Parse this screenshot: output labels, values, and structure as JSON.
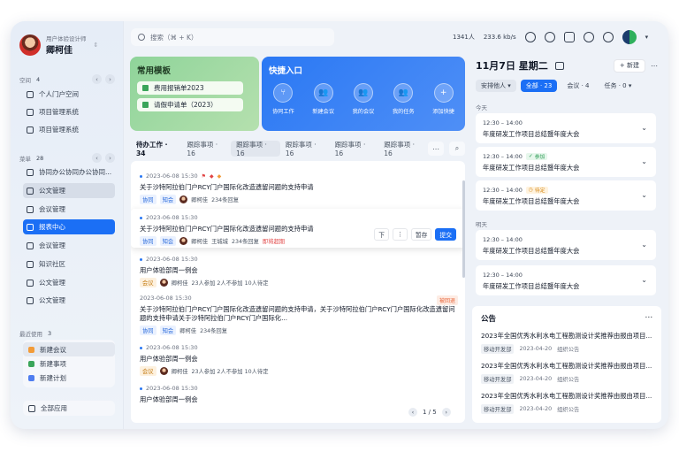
{
  "user": {
    "role": "用户体验设计师",
    "name": "卿柯佳"
  },
  "sidebar": {
    "space": {
      "label": "空间",
      "count": "4"
    },
    "space_items": [
      "个人门户空间",
      "项目管理系统",
      "项目管理系统"
    ],
    "menu": {
      "label": "菜单",
      "count": "28"
    },
    "menu_items": [
      "协同办公协同办公协同...",
      "公文管理",
      "会议管理",
      "报表中心",
      "会议管理",
      "知识社区",
      "公文管理",
      "公文管理"
    ],
    "recent": {
      "label": "最近使用",
      "count": "3"
    },
    "recent_items": [
      "新建会议",
      "新建事项",
      "新建计划"
    ],
    "all_apps": "全部应用"
  },
  "topbar": {
    "search_placeholder": "搜索（⌘ + K）",
    "users": "1341人",
    "speed": "233.6 kb/s",
    "icons": [
      "chat-icon",
      "contact-icon",
      "apps-icon",
      "headset-icon",
      "settings-icon"
    ]
  },
  "templates": {
    "title": "常用模板",
    "items": [
      "费用报销单2023",
      "请假申请单（2023）"
    ]
  },
  "quick": {
    "title": "快捷入口",
    "items": [
      "协同工作",
      "新建会议",
      "我的会议",
      "我的任务",
      "添加快捷"
    ]
  },
  "tabs": {
    "items": [
      "待办工作 · 34",
      "跟踪事项 · 16",
      "跟踪事项 · 16",
      "跟踪事项 · 16",
      "跟踪事项 · 16",
      "跟踪事项 · 16"
    ]
  },
  "list": {
    "items": [
      {
        "date": "2023-06-08 15:30",
        "title": "关于沙特阿拉伯门户RCY门户国际化改造遗留问题的支持申请",
        "tags": [
          "协同",
          "知会"
        ],
        "person": "卿柯佳",
        "extra": "234条回复"
      },
      {
        "date": "2023-06-08 15:30",
        "title": "关于沙特阿拉伯门户RCY门户国际化改造遗留问题的支持申请",
        "tags": [
          "协同",
          "知会"
        ],
        "person": "卿柯佳",
        "extra": "王城城",
        "extra2": "234条回复",
        "warn": "即将超期",
        "actions": [
          "下",
          "⋮",
          "暂存",
          "提交"
        ]
      },
      {
        "date": "2023-06-08 15:30",
        "title": "用户体验部周一例会",
        "tags": [
          "会议"
        ],
        "person": "卿柯佳",
        "extra": "23人参加 2人不参加 10人待定"
      },
      {
        "date": "2023-06-08 15:30",
        "title": "关于沙特阿拉伯门户RCY门户国际化改造遗留问题的支持申请，关于沙特阿拉伯门户RCY门户国际化改造遗留问题的支持申请关于沙特阿拉伯门户RCY门户国际化...",
        "tags": [
          "协同",
          "知会"
        ],
        "person": "卿柯佳",
        "extra": "234条回复",
        "rtag": "被回退"
      },
      {
        "date": "2023-06-08 15:30",
        "title": "用户体验部周一例会",
        "tags": [
          "会议"
        ],
        "person": "卿柯佳",
        "extra": "23人参加 2人不参加 10人待定"
      },
      {
        "date": "2023-06-08 15:30",
        "title": "用户体验部周一例会"
      }
    ],
    "pager": "1 / 5"
  },
  "calendar": {
    "date": "11月7日 星期二",
    "new_label": "+ 新建",
    "filters": [
      "安排他人 ▾",
      "全部 · 23",
      "会议 · 4",
      "任务 · 0 ▾"
    ],
    "today": "今天",
    "tomorrow": "明天",
    "events": [
      {
        "time": "12:30 – 14:00",
        "name": "年度研发工作项目总结暨年度大会"
      },
      {
        "time": "12:30 – 14:00",
        "name": "年度研发工作项目总结暨年度大会",
        "badge": "参加"
      },
      {
        "time": "12:30 – 14:00",
        "name": "年度研发工作项目总结暨年度大会",
        "badge": "待定"
      },
      {
        "time": "12:30 – 14:00",
        "name": "年度研发工作项目总结暨年度大会"
      },
      {
        "time": "12:30 – 14:00",
        "name": "年度研发工作项目总结暨年度大会"
      }
    ]
  },
  "notice": {
    "title": "公告",
    "items": [
      {
        "title": "2023年全国优秀水利水电工程勘测设计奖推荐由报由项目...",
        "src": "移动开发部",
        "date": "2023-04-20",
        "cat": "组织公告"
      },
      {
        "title": "2023年全国优秀水利水电工程勘测设计奖推荐由报由项目...",
        "src": "移动开发部",
        "date": "2023-04-20",
        "cat": "组织公告"
      },
      {
        "title": "2023年全国优秀水利水电工程勘测设计奖推荐由报由项目...",
        "src": "移动开发部",
        "date": "2023-04-20",
        "cat": "组织公告"
      }
    ]
  }
}
